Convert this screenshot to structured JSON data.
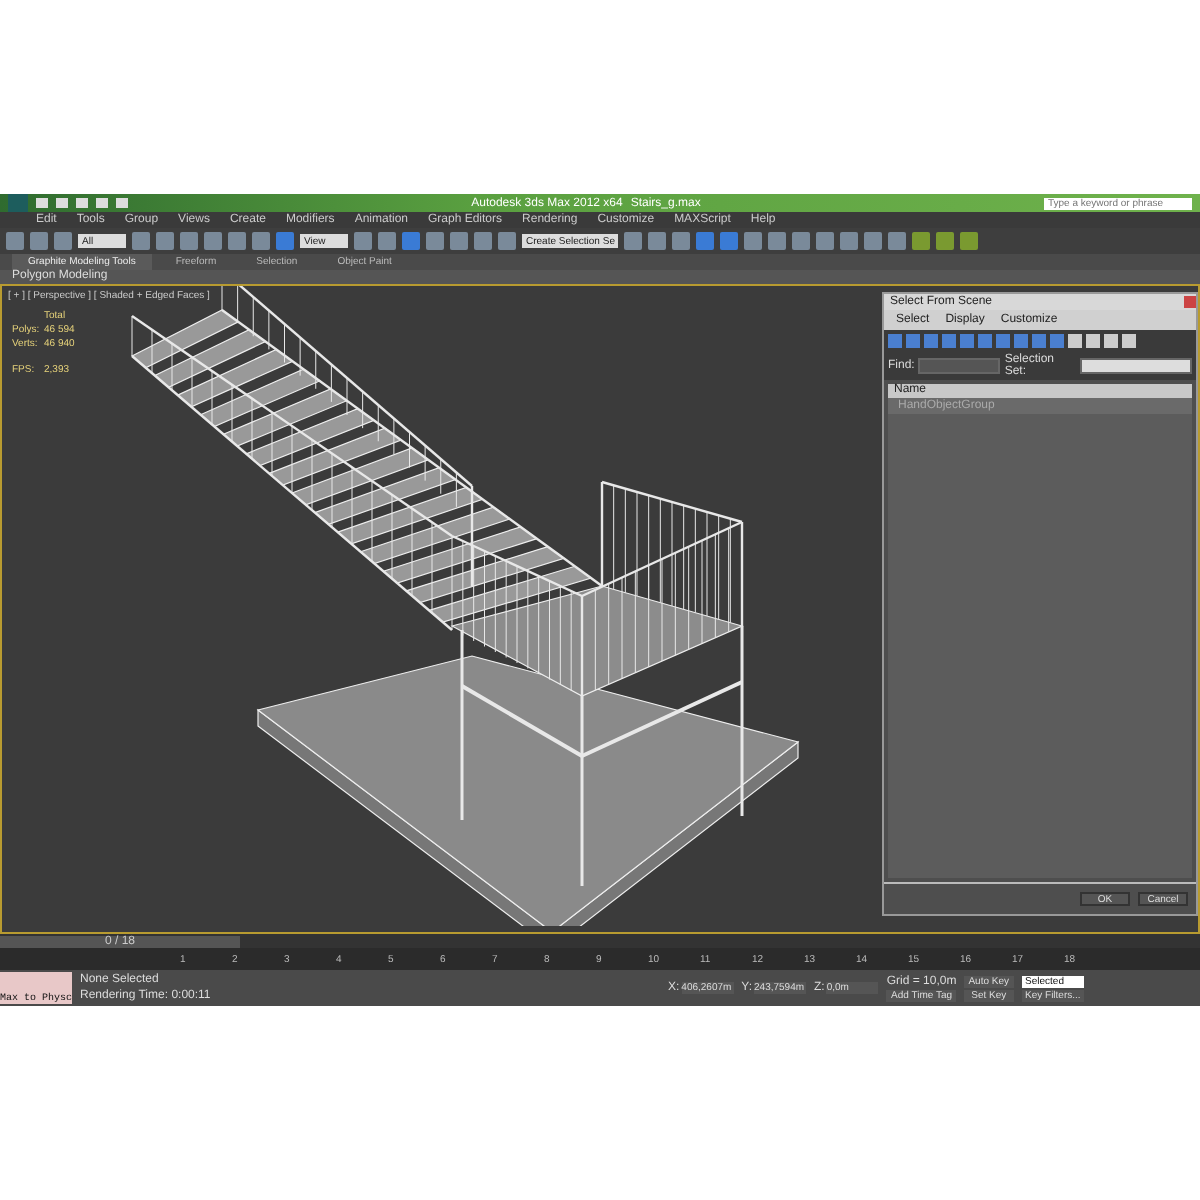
{
  "window": {
    "title": "Autodesk 3ds Max 2012 x64",
    "file": "Stairs_g.max"
  },
  "search": {
    "placeholder": "Type a keyword or phrase"
  },
  "menu": [
    "Edit",
    "Tools",
    "Group",
    "Views",
    "Create",
    "Modifiers",
    "Animation",
    "Graph Editors",
    "Rendering",
    "Customize",
    "MAXScript",
    "Help"
  ],
  "toolbar": {
    "dropdowns": [
      {
        "value": "All"
      },
      {
        "value": "View"
      },
      {
        "value": "Create Selection Se"
      }
    ]
  },
  "ribbon": {
    "tabs": [
      {
        "label": "Graphite Modeling Tools",
        "selected": true
      },
      {
        "label": "Freeform",
        "selected": false
      },
      {
        "label": "Selection",
        "selected": false
      },
      {
        "label": "Object Paint",
        "selected": false
      }
    ],
    "panel": "Polygon Modeling"
  },
  "viewport": {
    "label": "[ + ] [ Perspective ] [ Shaded + Edged Faces ]",
    "stats_header": "Total",
    "stats": [
      {
        "label": "Polys:",
        "value": "46 594"
      },
      {
        "label": "Verts:",
        "value": "46 940"
      }
    ],
    "fps_label": "FPS:",
    "fps": "2,393"
  },
  "dialog": {
    "title": "Select From Scene",
    "menu": [
      "Select",
      "Display",
      "Customize"
    ],
    "find_label": "Find:",
    "set_label": "Selection Set:",
    "column": "Name",
    "items": [
      {
        "name": "HandObjectGroup",
        "selected": true
      }
    ],
    "buttons": [
      "OK",
      "Cancel"
    ]
  },
  "timeline": {
    "position": "0 / 18",
    "ticks": [
      "1",
      "2",
      "3",
      "4",
      "5",
      "6",
      "7",
      "8",
      "9",
      "10",
      "11",
      "12",
      "13",
      "14",
      "15",
      "16",
      "17",
      "18"
    ]
  },
  "status": {
    "listener": "Max to Physc",
    "selection": "None Selected",
    "prompt": "Rendering Time: 0:00:11",
    "coords": [
      {
        "axis": "X:",
        "value": "406,2607m"
      },
      {
        "axis": "Y:",
        "value": "243,7594m"
      },
      {
        "axis": "Z:",
        "value": "0,0m"
      }
    ],
    "grid": "Grid = 10,0m",
    "time_tag": "Add Time Tag",
    "auto_key": "Auto Key",
    "key_mode": "Selected",
    "set_key": "Set Key",
    "key_filters": "Key Filters..."
  }
}
